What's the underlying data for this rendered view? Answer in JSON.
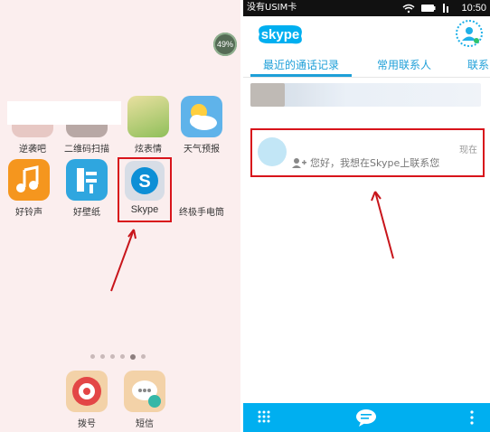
{
  "left_screen": {
    "battery_badge": "49%",
    "apps": [
      {
        "label": "逆袭吧",
        "icon": "nixiba-icon"
      },
      {
        "label": "二维码扫描",
        "icon": "qr-scanner-icon"
      },
      {
        "label": "炫表情",
        "icon": "emoji-icon"
      },
      {
        "label": "天气预报",
        "icon": "weather-icon"
      },
      {
        "label": "好铃声",
        "icon": "ringtone-icon"
      },
      {
        "label": "好壁纸",
        "icon": "wallpaper-icon"
      },
      {
        "label": "Skype",
        "icon": "skype-icon"
      },
      {
        "label": "终极手电筒",
        "icon": "flashlight-icon"
      }
    ],
    "dock": [
      {
        "label": "拨号",
        "icon": "phone-dial-icon"
      },
      {
        "label": "短信",
        "icon": "sms-icon"
      }
    ],
    "page_dots": {
      "count": 6,
      "active_index": 4
    },
    "colors": {
      "highlight": "#d8141b",
      "background": "#fbeeee"
    }
  },
  "right_screen": {
    "status_bar": {
      "carrier": "没有USIM卡",
      "time": "10:50"
    },
    "app_name": "skype",
    "tabs": [
      {
        "label": "最近的通话记录",
        "active": true
      },
      {
        "label": "常用联系人",
        "active": false
      },
      {
        "label": "联系",
        "active": false
      }
    ],
    "conversation": {
      "time": "现在",
      "message": "您好，我想在Skype上联系您"
    },
    "colors": {
      "brand": "#00aff0",
      "tab_accent": "#1e9fd8",
      "highlight": "#d8141b"
    }
  }
}
